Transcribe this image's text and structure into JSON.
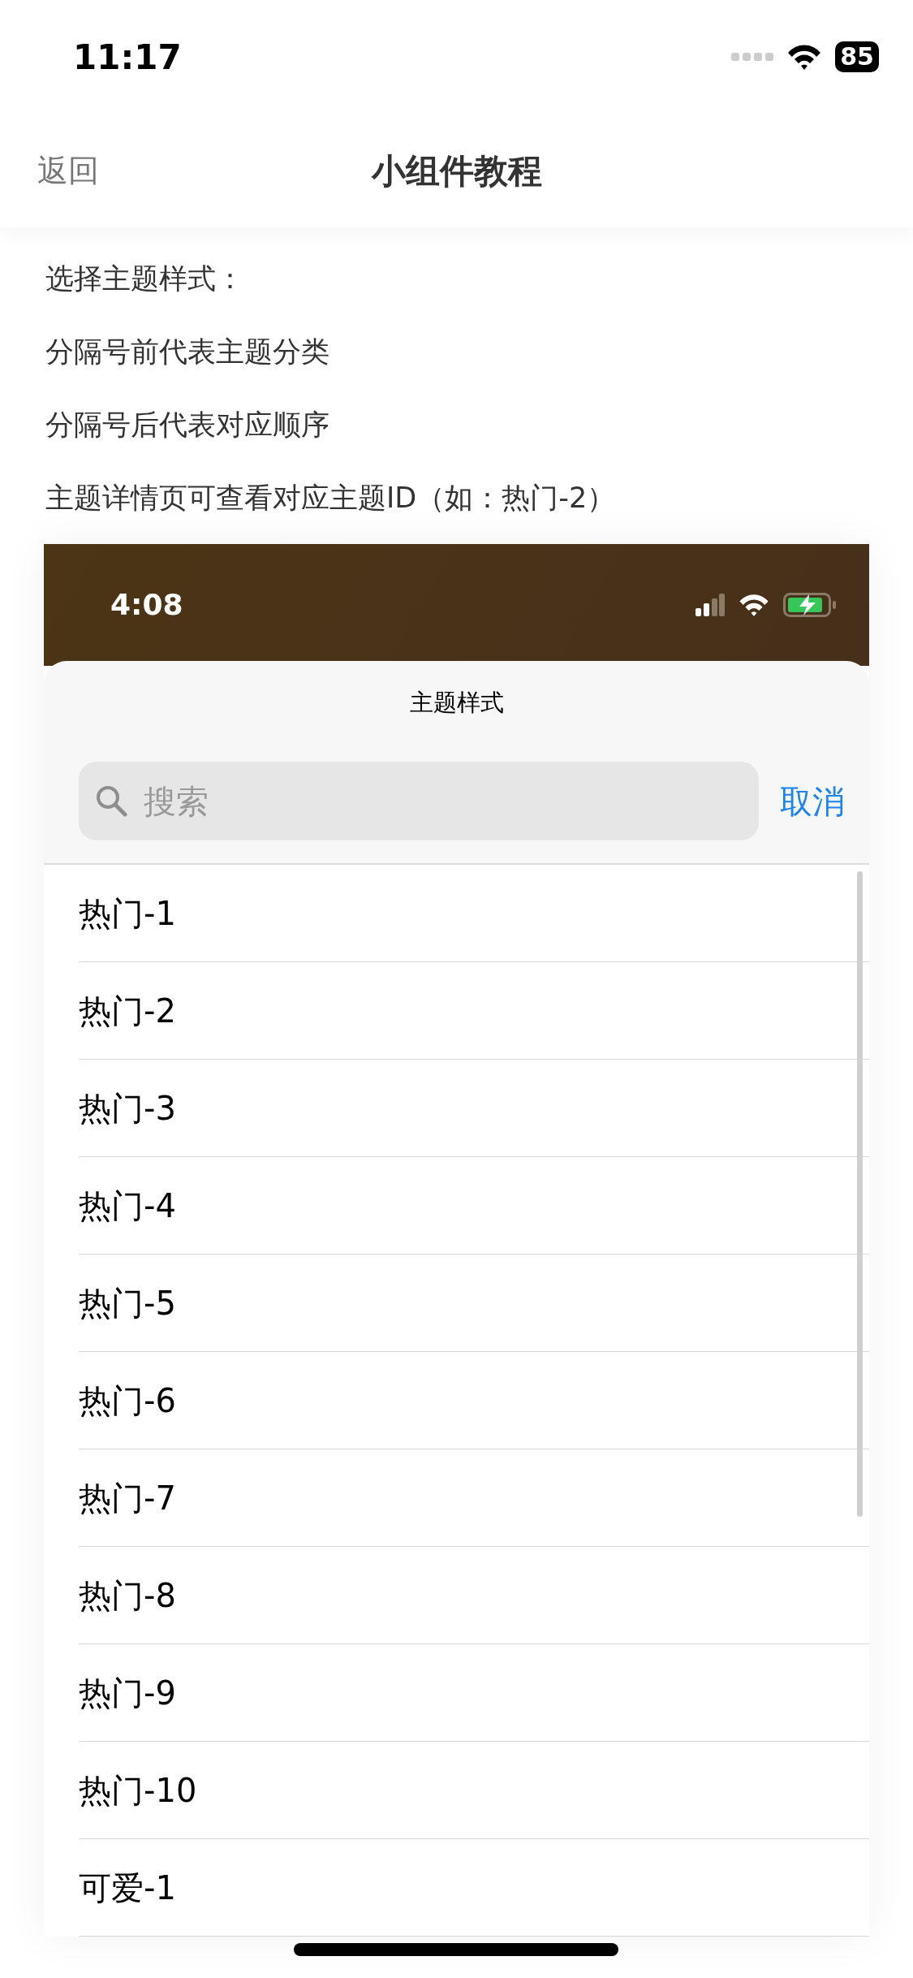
{
  "status_bar": {
    "time": "11:17",
    "battery": "85"
  },
  "nav": {
    "back": "返回",
    "title": "小组件教程"
  },
  "instructions": [
    "选择主题样式：",
    "分隔号前代表主题分类",
    "分隔号后代表对应顺序",
    "主题详情页可查看对应主题ID（如：热门-2）"
  ],
  "screenshot": {
    "status_bar": {
      "time": "4:08"
    },
    "sheet": {
      "title": "主题样式",
      "search": {
        "placeholder": "搜索"
      },
      "cancel": "取消",
      "items": [
        "热门-1",
        "热门-2",
        "热门-3",
        "热门-4",
        "热门-5",
        "热门-6",
        "热门-7",
        "热门-8",
        "热门-9",
        "热门-10",
        "可爱-1"
      ]
    }
  }
}
